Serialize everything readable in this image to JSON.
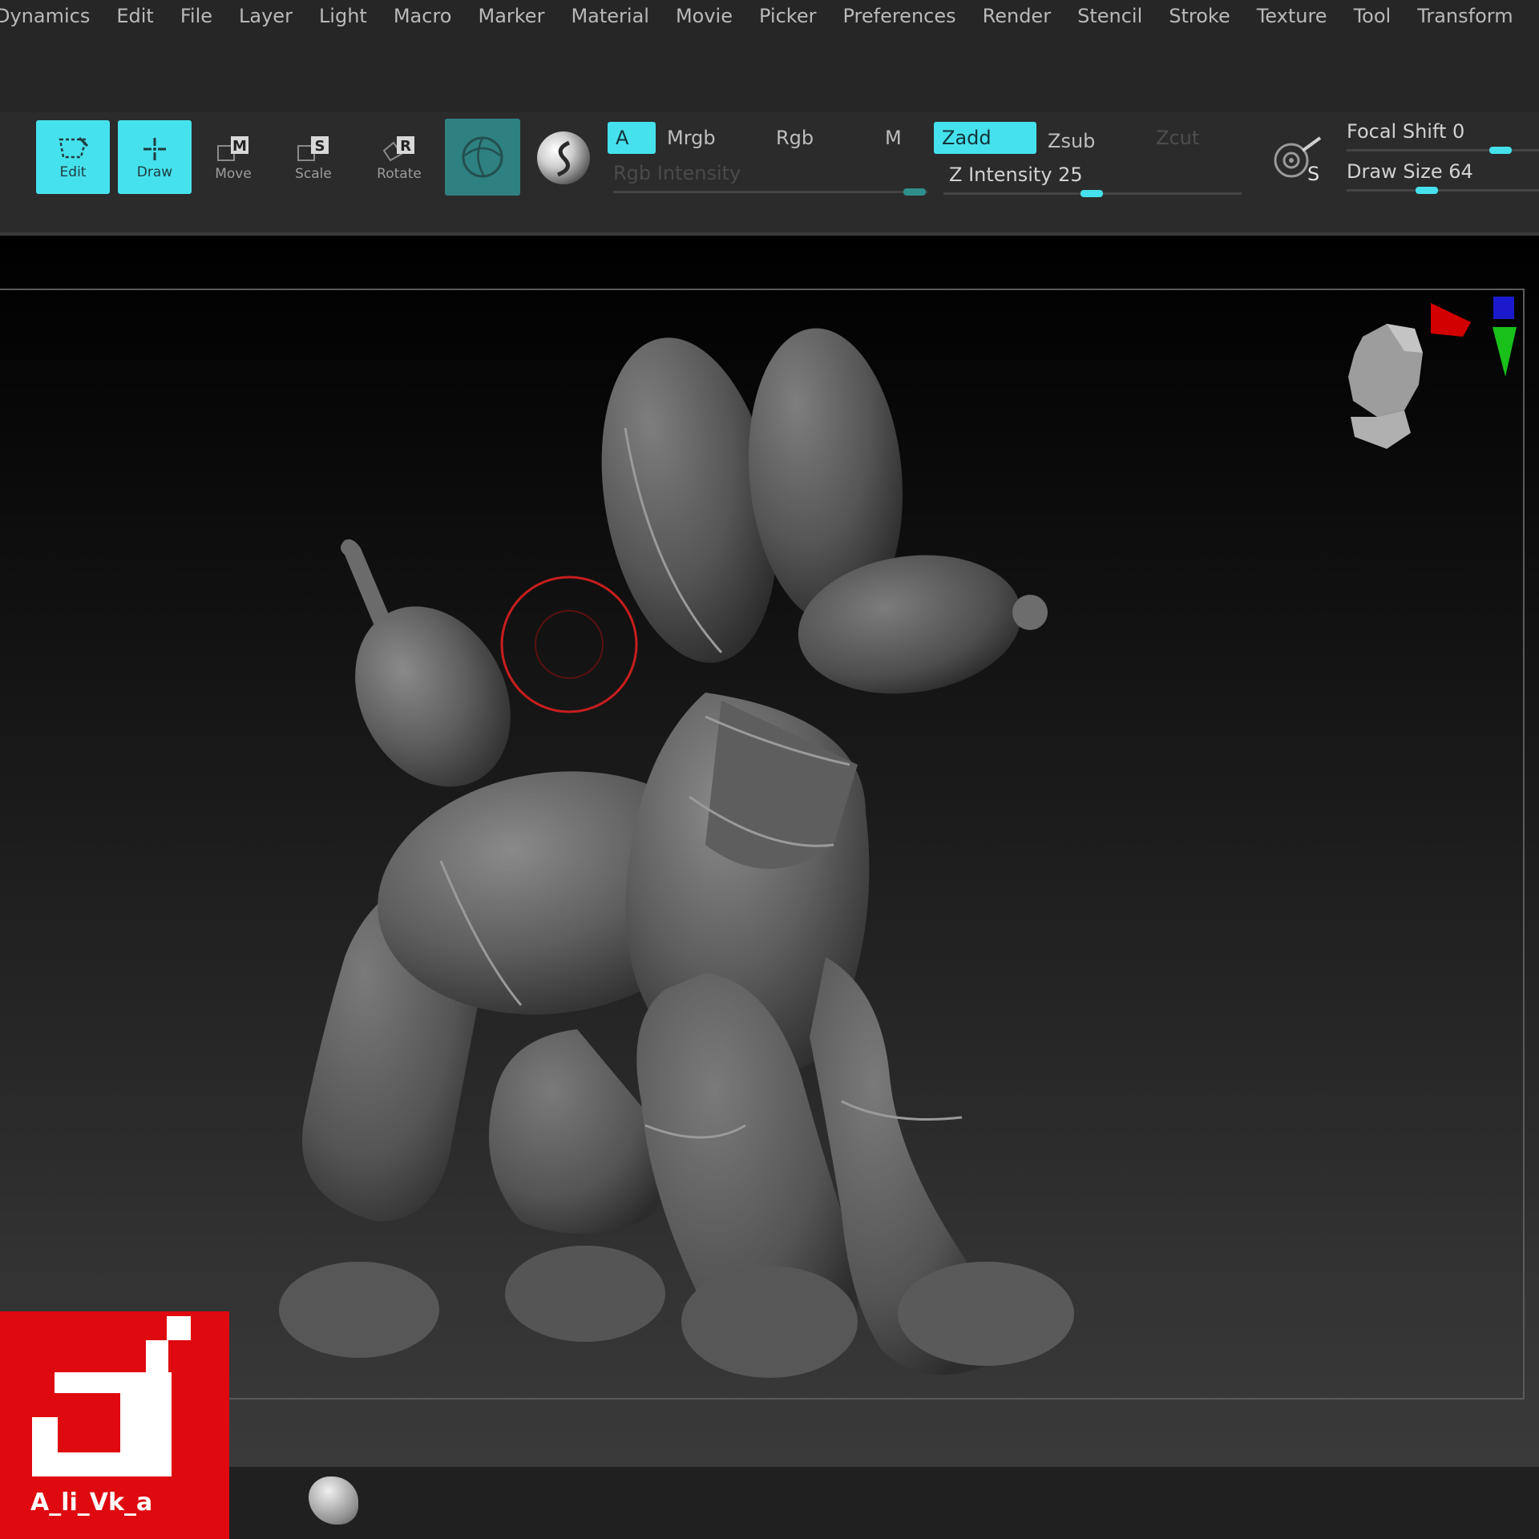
{
  "menu": [
    "Dynamics",
    "Edit",
    "File",
    "Layer",
    "Light",
    "Macro",
    "Marker",
    "Material",
    "Movie",
    "Picker",
    "Preferences",
    "Render",
    "Stencil",
    "Stroke",
    "Texture",
    "Tool",
    "Transform"
  ],
  "toolbar": {
    "edit_label": "Edit",
    "draw_label": "Draw",
    "move_label": "Move",
    "scale_label": "Scale",
    "rotate_label": "Rotate",
    "move_key": "M",
    "scale_key": "S",
    "rotate_key": "R",
    "a_label": "A",
    "mrgb_label": "Mrgb",
    "rgb_label": "Rgb",
    "m_label": "M",
    "zadd_label": "Zadd",
    "zsub_label": "Zsub",
    "zcut_label": "Zcut",
    "rgb_intensity_label": "Rgb Intensity",
    "z_intensity_label": "Z Intensity 25",
    "focal_shift_label": "Focal Shift 0",
    "draw_size_label": "Draw Size 64",
    "lightbox_s_label": "S"
  },
  "sliders": {
    "rgb_intensity": 1.0,
    "z_intensity": 0.25,
    "focal_shift": 0.5,
    "draw_size": 0.4
  },
  "colors": {
    "accent": "#45e1ec",
    "material_button": "#2f8080",
    "cursor_ring": "#c81e1e",
    "axis_x": "#ff1a1a",
    "axis_y": "#19e619",
    "axis_z": "#1a1aff",
    "logo_bg": "#de0a10"
  },
  "watermark": {
    "text": "A_li_Vk_a"
  }
}
